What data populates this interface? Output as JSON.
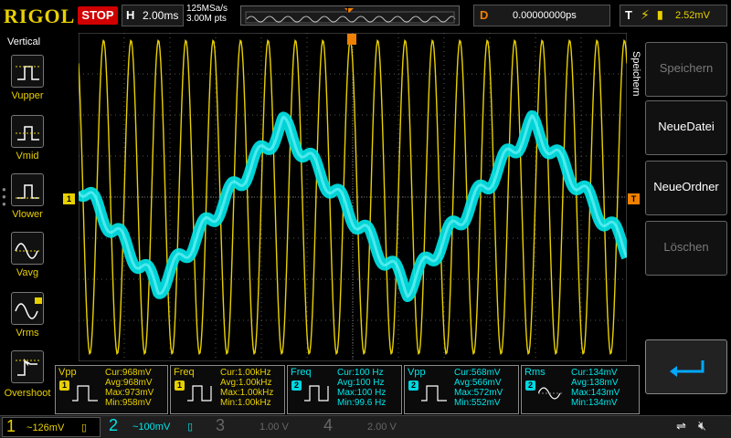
{
  "header": {
    "logo": "RIGOL",
    "run_status": "STOP",
    "timebase_key": "H",
    "timebase_value": "2.00ms",
    "sample_rate": "125MSa/s",
    "memory_depth": "3.00M pts",
    "trigger_marker": "T",
    "delay_key": "D",
    "delay_value": "0.00000000ps",
    "trigger_key": "T",
    "trigger_level": "2.52mV"
  },
  "left_panel": {
    "title": "Vertical",
    "items": [
      {
        "label": "Vupper",
        "icon": "vupper-measure-icon"
      },
      {
        "label": "Vmid",
        "icon": "vmid-measure-icon"
      },
      {
        "label": "Vlower",
        "icon": "vlower-measure-icon"
      },
      {
        "label": "Vavg",
        "icon": "vavg-measure-icon"
      },
      {
        "label": "Vrms",
        "icon": "vrms-measure-icon"
      },
      {
        "label": "Overshoot",
        "icon": "overshoot-measure-icon"
      }
    ]
  },
  "right_panel": {
    "title": "Speichern",
    "buttons": [
      {
        "label": "Speichern",
        "enabled": false
      },
      {
        "label": "NeueDatei",
        "enabled": true
      },
      {
        "label": "NeueOrdner",
        "enabled": true
      },
      {
        "label": "Löschen",
        "enabled": false
      }
    ],
    "back_icon": "return-arrow-icon"
  },
  "markers": {
    "ch1_left": "1",
    "trigger_level": "T"
  },
  "measurements": [
    {
      "name": "Vpp",
      "channel": "1",
      "lines": [
        "Cur:968mV",
        "Avg:968mV",
        "Max:973mV",
        "Min:958mV"
      ]
    },
    {
      "name": "Freq",
      "channel": "1",
      "lines": [
        "Cur:1.00kHz",
        "Avg:1.00kHz",
        "Max:1.00kHz",
        "Min:1.00kHz"
      ]
    },
    {
      "name": "Freq",
      "channel": "2",
      "lines": [
        "Cur:100 Hz",
        "Avg:100 Hz",
        "Max:100 Hz",
        "Min:99.6 Hz"
      ]
    },
    {
      "name": "Vpp",
      "channel": "2",
      "lines": [
        "Cur:568mV",
        "Avg:566mV",
        "Max:572mV",
        "Min:552mV"
      ]
    },
    {
      "name": "Rms",
      "channel": "2",
      "lines": [
        "Cur:134mV",
        "Avg:138mV",
        "Max:143mV",
        "Min:134mV"
      ]
    }
  ],
  "channels": [
    {
      "num": "1",
      "value": "126mV",
      "coupling": "~",
      "color": "#e8d000"
    },
    {
      "num": "2",
      "value": "100mV",
      "coupling": "~",
      "color": "#00e5e8"
    },
    {
      "num": "3",
      "value": "1.00 V",
      "coupling": "",
      "color": "#666666"
    },
    {
      "num": "4",
      "value": "2.00 V",
      "coupling": "",
      "color": "#666666"
    }
  ],
  "colors": {
    "ch1": "#e8d000",
    "ch2": "#00e5e8",
    "stop": "#d10000",
    "delay": "#f08000"
  },
  "waveforms": {
    "ch1": {
      "shape": "sine",
      "frequency": "1.00kHz"
    },
    "ch2": {
      "shape": "triangle with stepped ripple",
      "frequency": "100 Hz"
    }
  }
}
